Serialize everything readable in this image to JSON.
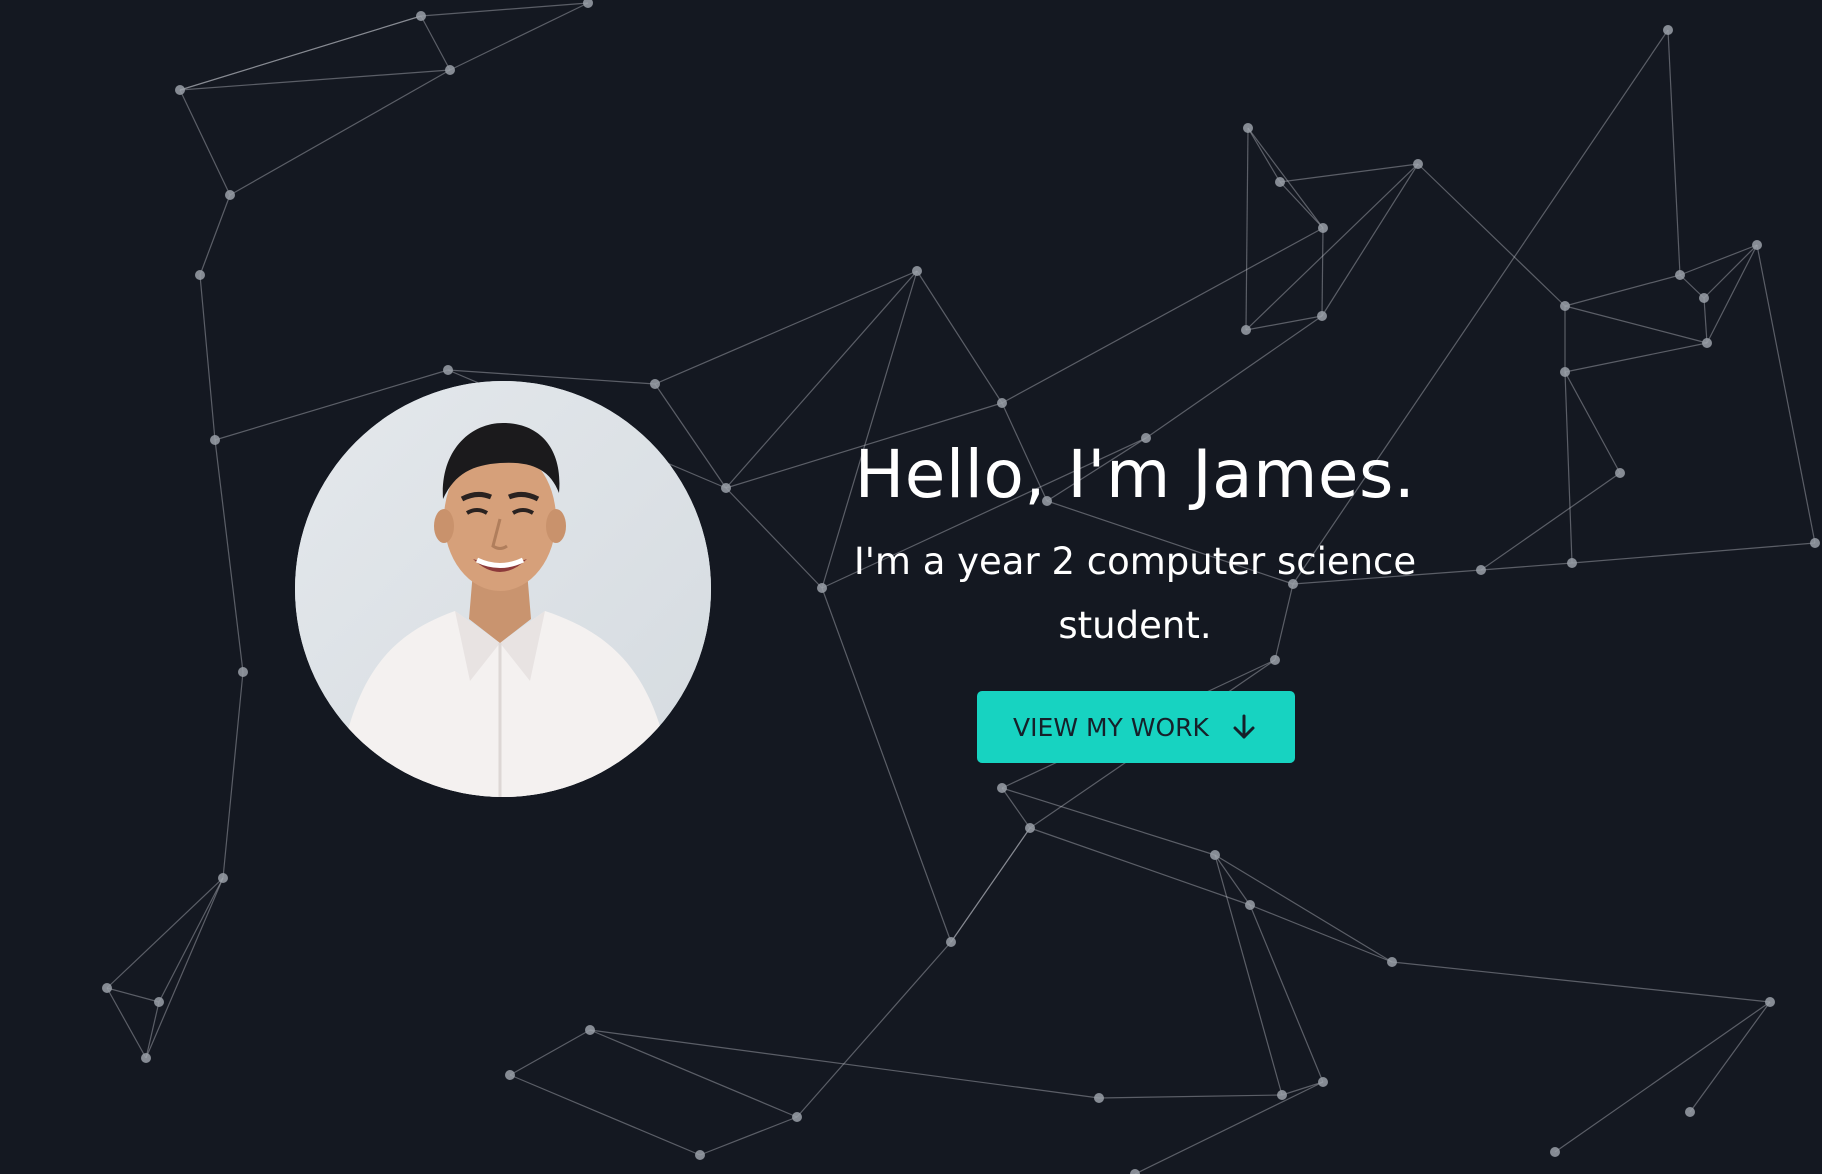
{
  "hero": {
    "greeting": "Hello, I'm James.",
    "tagline": "I'm a year 2 computer science student.",
    "cta_label": "VIEW MY WORK",
    "cta_icon": "arrow-down-icon",
    "accent_color": "#17d3c1",
    "background_color": "#141821"
  },
  "avatar": {
    "alt": "Profile photo of James"
  }
}
